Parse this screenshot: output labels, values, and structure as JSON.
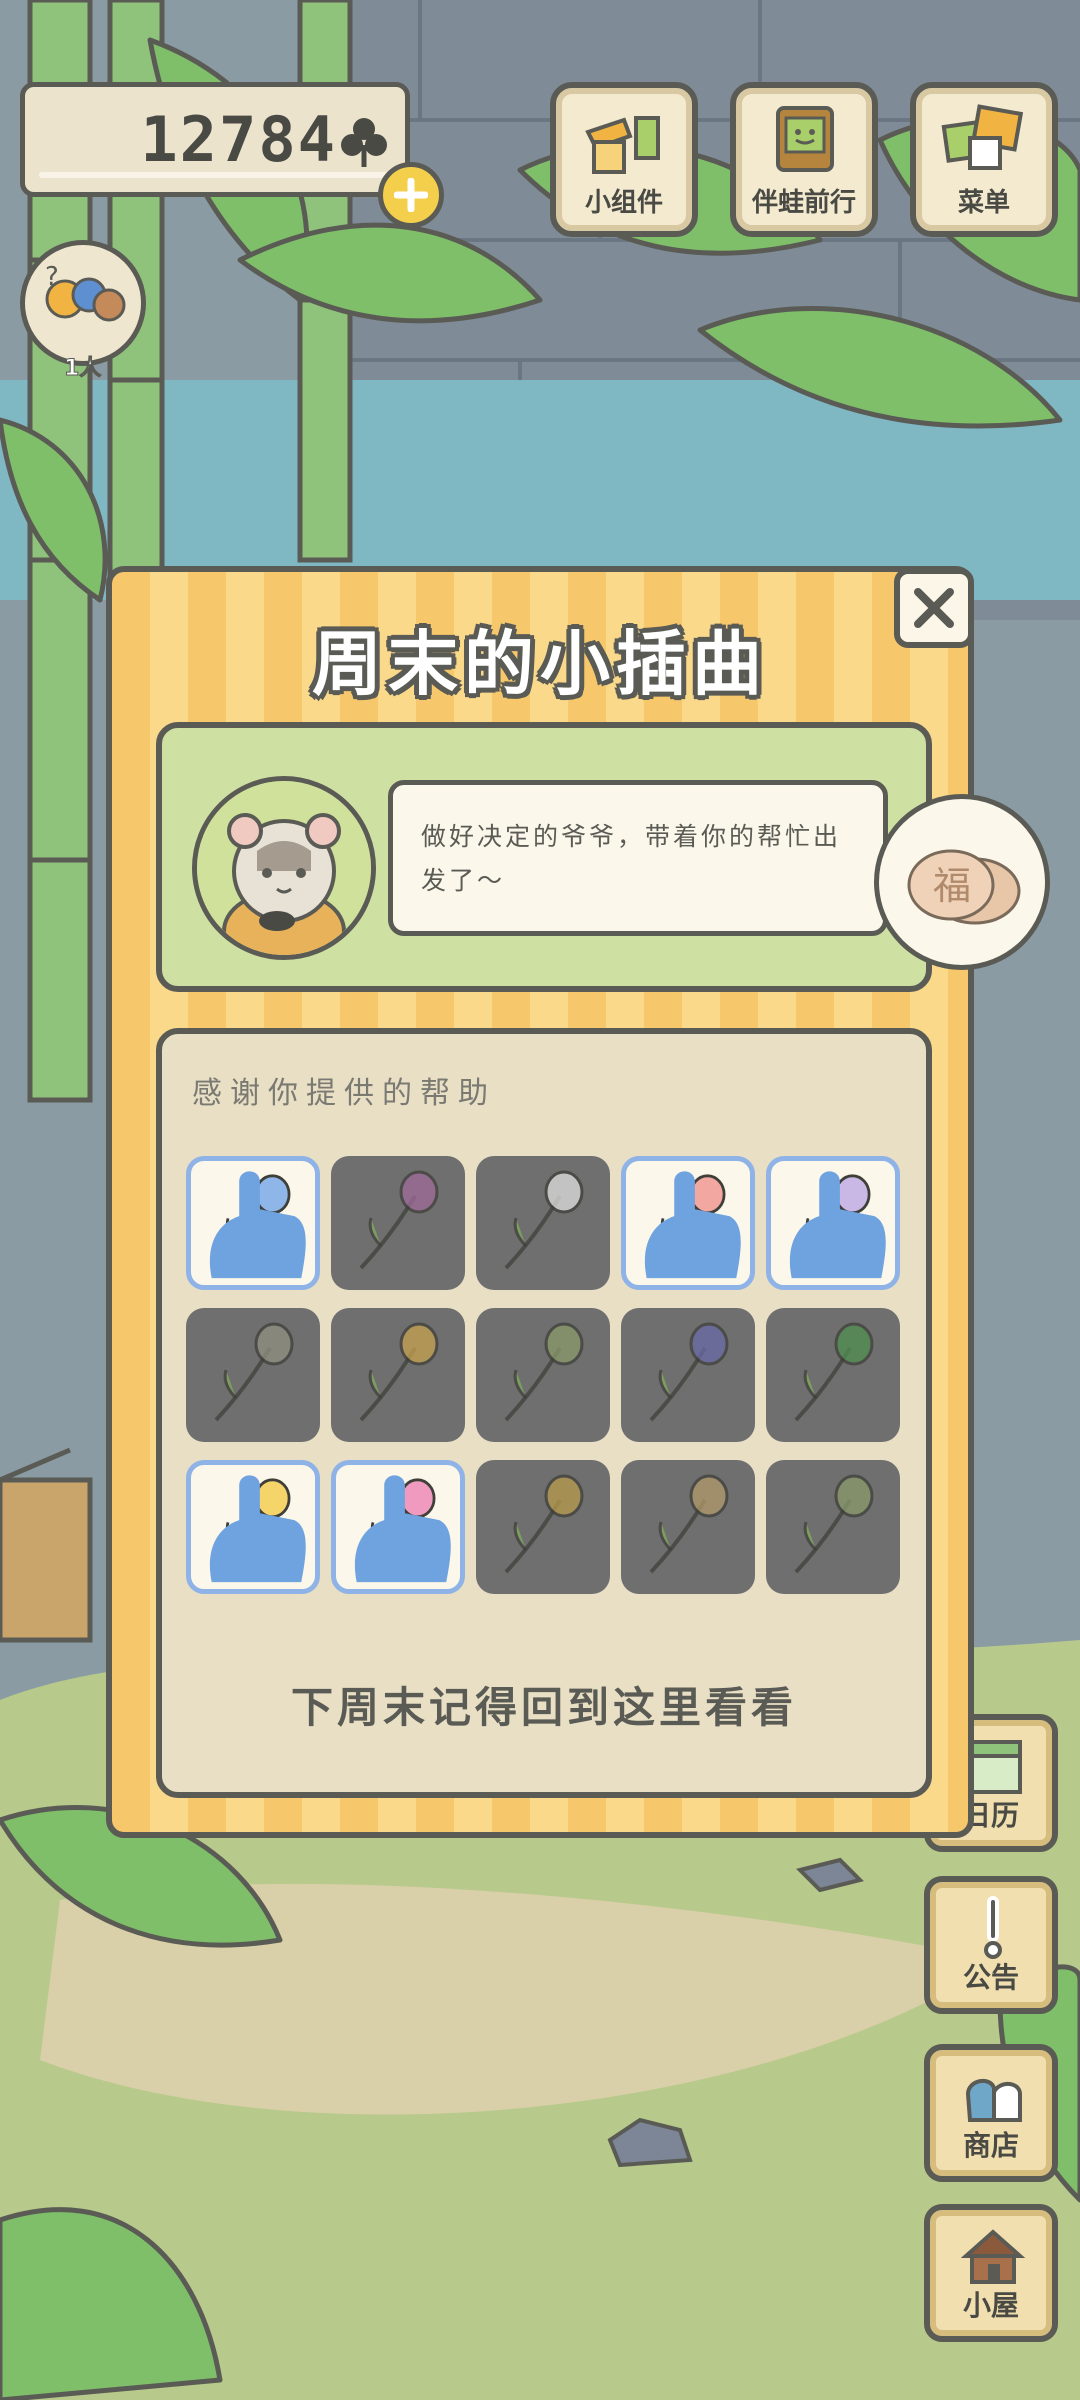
{
  "hud": {
    "clover_count": "12784",
    "visitor_count": "1人"
  },
  "top_buttons": [
    {
      "label": "小组件",
      "icon": "widget-icon"
    },
    {
      "label": "伴蛙前行",
      "icon": "frog-journey-icon"
    },
    {
      "label": "菜单",
      "icon": "menu-icon"
    }
  ],
  "side_buttons": [
    {
      "label": "日历",
      "icon": "calendar-icon"
    },
    {
      "label": "公告",
      "icon": "notice-icon"
    },
    {
      "label": "商店",
      "icon": "shop-icon"
    },
    {
      "label": "小屋",
      "icon": "house-icon"
    }
  ],
  "modal": {
    "title": "周末的小插曲",
    "speech": "做好决定的爷爷，带着你的帮忙出发了～",
    "thanks_title": "感谢你提供的帮助",
    "footer": "下周末记得回到这里看看",
    "reward_icon": "coin-reward-icon",
    "items": [
      {
        "name": "blue-lily",
        "state": "active"
      },
      {
        "name": "lavender",
        "state": "locked"
      },
      {
        "name": "white-lily",
        "state": "locked"
      },
      {
        "name": "hyacinth",
        "state": "active"
      },
      {
        "name": "lilac",
        "state": "active"
      },
      {
        "name": "twig-flower",
        "state": "locked"
      },
      {
        "name": "yellow-flower",
        "state": "locked"
      },
      {
        "name": "grass-sprig",
        "state": "locked"
      },
      {
        "name": "pansy",
        "state": "locked"
      },
      {
        "name": "four-leaf-clover",
        "state": "locked"
      },
      {
        "name": "tulip",
        "state": "active"
      },
      {
        "name": "azalea",
        "state": "active"
      },
      {
        "name": "osmanthus",
        "state": "locked"
      },
      {
        "name": "plum-blossom",
        "state": "locked"
      },
      {
        "name": "buds",
        "state": "locked"
      }
    ]
  },
  "colors": {
    "outline": "#5b5b55",
    "modal_stripe_a": "#f7c86b",
    "modal_stripe_b": "#fbd98b",
    "active_border": "#8fb3e6",
    "locked_cell": "#6f6f6f"
  }
}
